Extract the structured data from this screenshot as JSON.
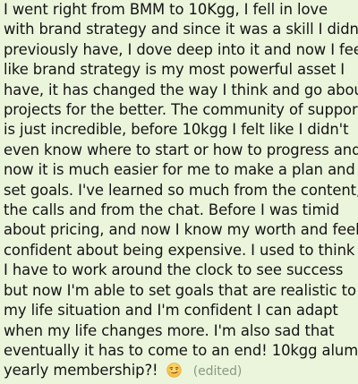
{
  "message": {
    "lines": [
      "I went right from BMM to 10Kgg, I fell in love",
      "with brand strategy and since it was a skill I didn't",
      "previously have, I dove deep into it and now I feel",
      "like brand strategy is my most powerful asset I",
      "have, it has changed the way I think and go about",
      "projects for the better. The community of support",
      "is just incredible, before 10kgg I felt like I didn't",
      "even know where to start or how to progress and",
      "now  it is much easier for me to make a plan and",
      "set goals. I've learned so much from the content,",
      "the calls and from the chat. Before I was timid",
      "about pricing, and now I know my worth and feel",
      "confident about being expensive.  I used to think",
      "I have to work around the clock to see success",
      "but now I'm able to set goals that are realistic to",
      "my life situation and I'm confident I can adapt",
      "when my life changes more.  I'm also sad that",
      "eventually it has to come to an end! 10kgg alum"
    ],
    "last_line": "yearly membership?!",
    "emoji_icon": "smirking-face-emoji",
    "edited_label": "(edited)"
  },
  "colors": {
    "bubble_background": "#ebf5dc",
    "text": "#141414",
    "meta_text": "#8a9a82"
  }
}
